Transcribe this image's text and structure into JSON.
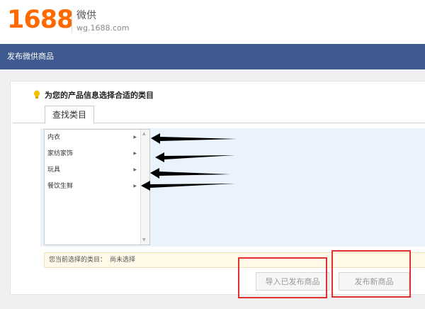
{
  "header": {
    "logo": "1688",
    "brand": "微供",
    "domain": "wg.1688.com"
  },
  "nav": {
    "title": "发布微供商品"
  },
  "tip": {
    "text": "为您的产品信息选择合适的类目"
  },
  "tabs": [
    {
      "label": "查找类目",
      "active": true
    }
  ],
  "categories": [
    {
      "label": "内衣"
    },
    {
      "label": "家纺家饰"
    },
    {
      "label": "玩具"
    },
    {
      "label": "餐饮生鲜"
    }
  ],
  "status": {
    "label": "您当前选择的类目：",
    "value": "尚未选择"
  },
  "buttons": {
    "import_label": "导入已发布商品",
    "publish_label": "发布新商品"
  },
  "colors": {
    "brand_orange": "#ff6a00",
    "nav_blue": "#3e5a8e",
    "highlight_red": "#e03030",
    "tip_bulb": "#f5c200"
  },
  "icons": {
    "tip": "lightbulb-icon",
    "category_arrow": "triangle-right-icon",
    "scroll_up": "triangle-up-icon",
    "scroll_down": "triangle-down-icon"
  }
}
